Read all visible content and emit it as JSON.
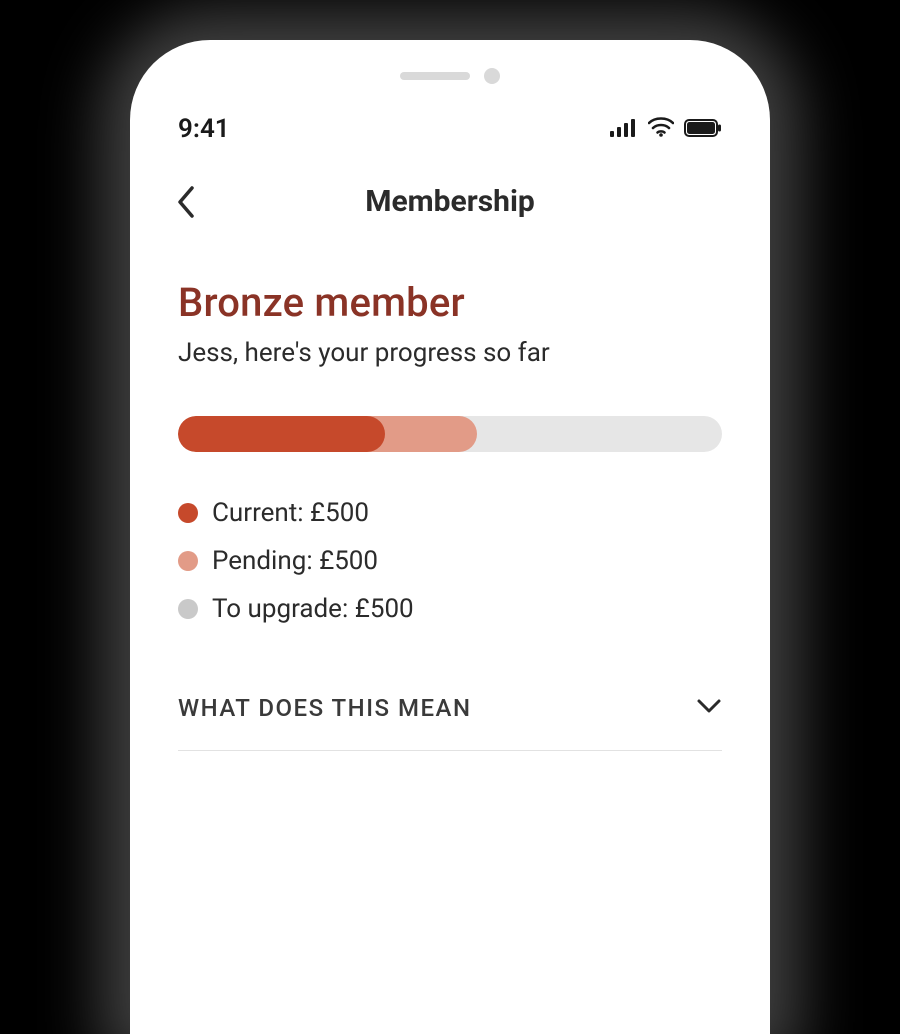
{
  "status": {
    "time": "9:41"
  },
  "nav": {
    "title": "Membership"
  },
  "membership": {
    "tier": "Bronze member",
    "subtitle": "Jess, here's your progress so far",
    "progress": {
      "current_pct": 38,
      "pending_pct": 55
    },
    "legend": {
      "current": "Current: £500",
      "pending": "Pending: £500",
      "upgrade": "To upgrade: £500"
    }
  },
  "accordion": {
    "label": "WHAT DOES THIS MEAN"
  },
  "colors": {
    "tier_text": "#8a3326",
    "current": "#c6492b",
    "pending": "#e29b87",
    "track": "#e6e6e6"
  }
}
